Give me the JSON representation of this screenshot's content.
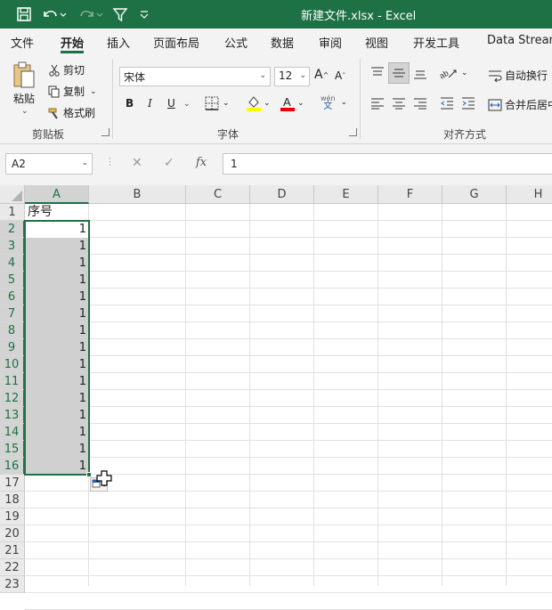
{
  "titlebar": {
    "title": "新建文件.xlsx  -  Excel",
    "save_icon": "save-icon",
    "undo_icon": "undo-icon",
    "redo_icon": "redo-icon",
    "filter_icon": "filter-icon",
    "customize_icon": "customize-qat-icon"
  },
  "tabs": [
    "文件",
    "开始",
    "插入",
    "页面布局",
    "公式",
    "数据",
    "审阅",
    "视图",
    "开发工具",
    "Data Stream"
  ],
  "active_tab": "开始",
  "ribbon": {
    "clipboard": {
      "paste": "粘贴",
      "cut": "剪切",
      "copy": "复制",
      "format_painter": "格式刷",
      "group_label": "剪贴板"
    },
    "font": {
      "font_name": "宋体",
      "font_size": "12",
      "bold": "B",
      "italic": "I",
      "underline": "U",
      "grow": "A",
      "shrink": "A",
      "font_color": "A",
      "phonetic": "wén",
      "phonetic_sub": "文",
      "group_label": "字体"
    },
    "alignment": {
      "wrap_text": "自动换行",
      "merge_center": "合并后居中",
      "group_label": "对齐方式"
    }
  },
  "formula_bar": {
    "name_box": "A2",
    "fx": "fx",
    "formula": "1"
  },
  "sheet": {
    "columns": [
      "A",
      "B",
      "C",
      "D",
      "E",
      "F",
      "G",
      "H"
    ],
    "rows": [
      "1",
      "2",
      "3",
      "4",
      "5",
      "6",
      "7",
      "8",
      "9",
      "10",
      "11",
      "12",
      "13",
      "14",
      "15",
      "16",
      "17",
      "18",
      "19",
      "20",
      "21",
      "22",
      "23"
    ],
    "header_cell": "序号",
    "values": [
      "1",
      "1",
      "1",
      "1",
      "1",
      "1",
      "1",
      "1",
      "1",
      "1",
      "1",
      "1",
      "1",
      "1",
      "1"
    ],
    "selection": "A2:A16",
    "accent_color": "#1e7145"
  }
}
